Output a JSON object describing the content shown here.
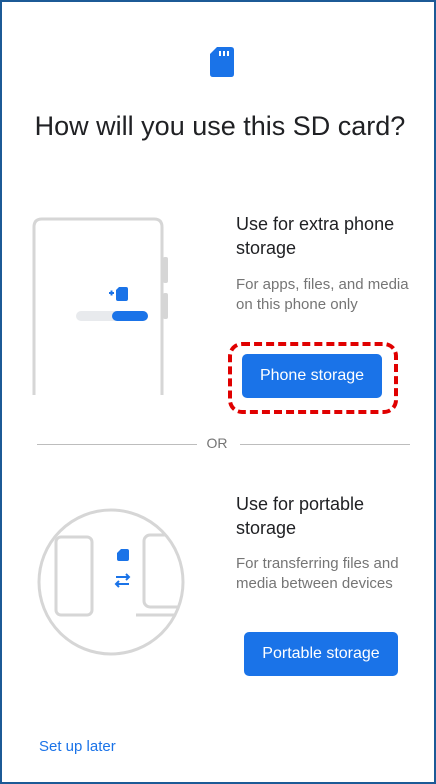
{
  "title": "How will you use this SD card?",
  "option_phone": {
    "heading": "Use for extra phone storage",
    "description": "For apps, files, and media on this phone only",
    "button_label": "Phone storage"
  },
  "divider_label": "OR",
  "option_portable": {
    "heading": "Use for portable storage",
    "description": "For transferring files and media between devices",
    "button_label": "Portable storage"
  },
  "footer": {
    "setup_later_label": "Set up later"
  },
  "colors": {
    "accent": "#1a73e8",
    "highlight": "#e00000",
    "frame": "#1c5a96"
  },
  "icons": {
    "top": "sd-card-icon",
    "illustration_phone": "phone-illustration",
    "illustration_portable": "portable-devices-illustration"
  }
}
